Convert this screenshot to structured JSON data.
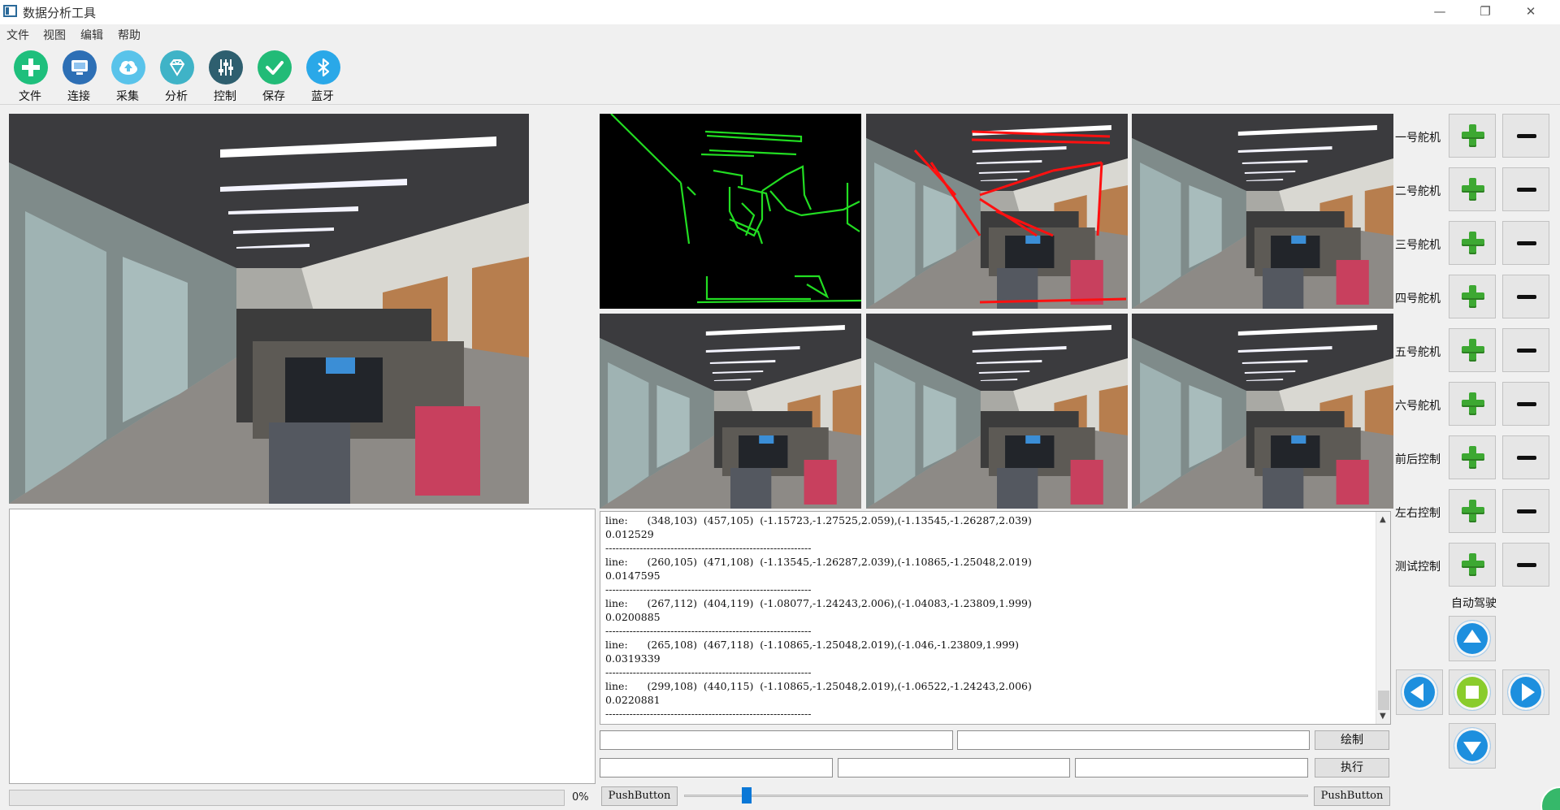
{
  "window": {
    "title": "数据分析工具",
    "controls": {
      "minimize": "—",
      "maximize": "❐",
      "close": "✕"
    }
  },
  "menu": [
    "文件",
    "视图",
    "编辑",
    "帮助"
  ],
  "toolbar": [
    {
      "label": "文件",
      "icon": "plus-icon",
      "color": "#1ebf7c"
    },
    {
      "label": "连接",
      "icon": "monitor-icon",
      "color": "#2d6fb5"
    },
    {
      "label": "采集",
      "icon": "cloud-upload-icon",
      "color": "#59c3ea"
    },
    {
      "label": "分析",
      "icon": "diamond-icon",
      "color": "#3fb3c7"
    },
    {
      "label": "控制",
      "icon": "sliders-icon",
      "color": "#2e5f6f"
    },
    {
      "label": "保存",
      "icon": "check-icon",
      "color": "#22bb77"
    },
    {
      "label": "蓝牙",
      "icon": "bluetooth-icon",
      "color": "#2aa8e8"
    }
  ],
  "log": {
    "lines": [
      "line:      (348,103)  (457,105)  (-1.15723,-1.27525,2.059),(-1.13545,-1.26287,2.039)",
      "0.012529",
      "------------------------------------------------------------",
      "line:      (260,105)  (471,108)  (-1.13545,-1.26287,2.039),(-1.10865,-1.25048,2.019)",
      "0.0147595",
      "------------------------------------------------------------",
      "line:      (267,112)  (404,119)  (-1.08077,-1.24243,2.006),(-1.04083,-1.23809,1.999)",
      "0.0200885",
      "------------------------------------------------------------",
      "line:      (265,108)  (467,118)  (-1.10865,-1.25048,2.019),(-1.046,-1.23809,1.999)",
      "0.0319339",
      "------------------------------------------------------------",
      "line:      (299,108)  (440,115)  (-1.10865,-1.25048,2.019),(-1.06522,-1.24243,2.006)",
      "0.0220881",
      "------------------------------------------------------------"
    ]
  },
  "controls": {
    "draw_button": "绘制",
    "exec_button": "执行",
    "push_left": "PushButton",
    "push_right": "PushButton",
    "progress_text": "0%",
    "progress_value": 0,
    "slider_value": 0.1
  },
  "servos": [
    "一号舵机",
    "二号舵机",
    "三号舵机",
    "四号舵机",
    "五号舵机",
    "六号舵机",
    "前后控制",
    "左右控制",
    "测试控制"
  ],
  "auto_label": "自动驾驶"
}
